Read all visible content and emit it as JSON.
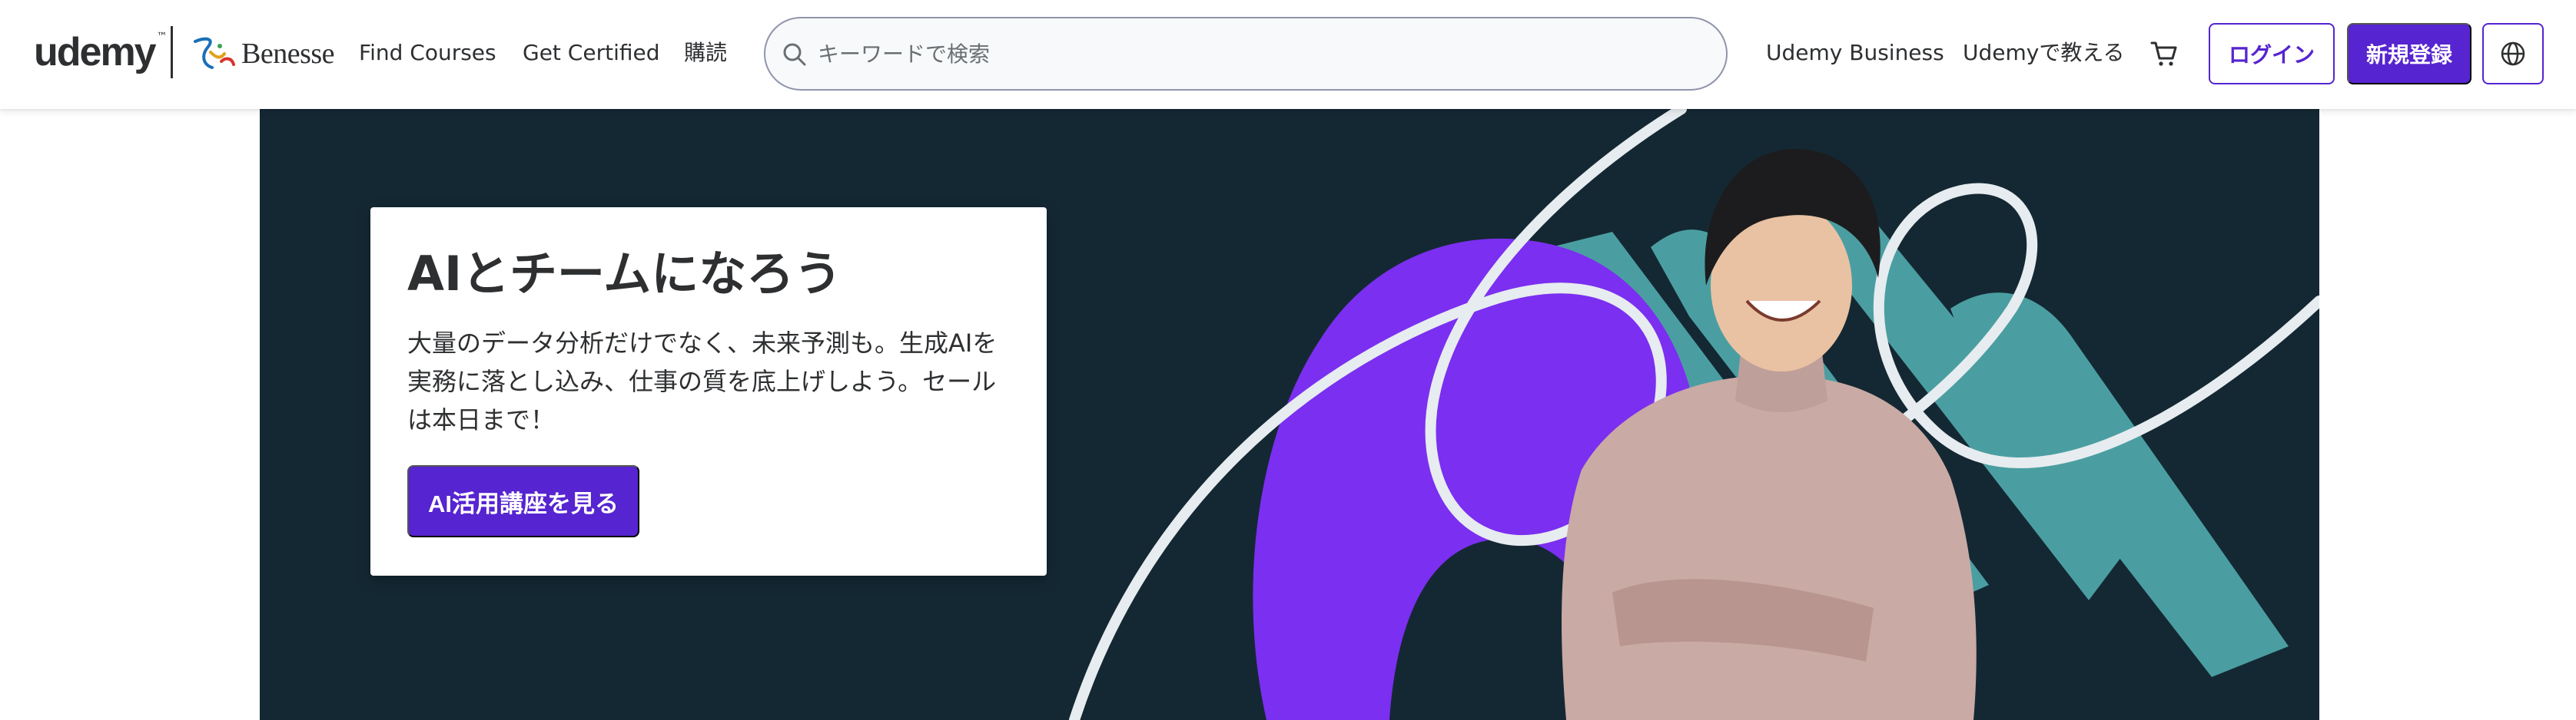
{
  "header": {
    "logo_text": "udemy",
    "logo_tm": "™",
    "partner_name": "Benesse",
    "nav": {
      "find_courses": "Find Courses",
      "get_certified": "Get Certified",
      "subscribe": "購読",
      "udemy_business": "Udemy Business",
      "teach": "Udemyで教える"
    },
    "search": {
      "placeholder": "キーワードで検索",
      "value": ""
    },
    "login_label": "ログイン",
    "signup_label": "新規登録",
    "icons": [
      "search-icon",
      "cart-icon",
      "globe-icon"
    ]
  },
  "hero": {
    "title": "AIとチームになろう",
    "text": "大量のデータ分析だけでなく、未来予測も。生成AIを実務に落とし込み、仕事の質を底上げしよう。セールは本日まで！",
    "cta_label": "AI活用講座を見る"
  },
  "colors": {
    "brand_purple": "#5624d0",
    "hero_background": "#142833",
    "accent_teal": "#4a9ea1",
    "accent_violet": "#7b2ff0",
    "text_dark": "#2d2f31"
  }
}
